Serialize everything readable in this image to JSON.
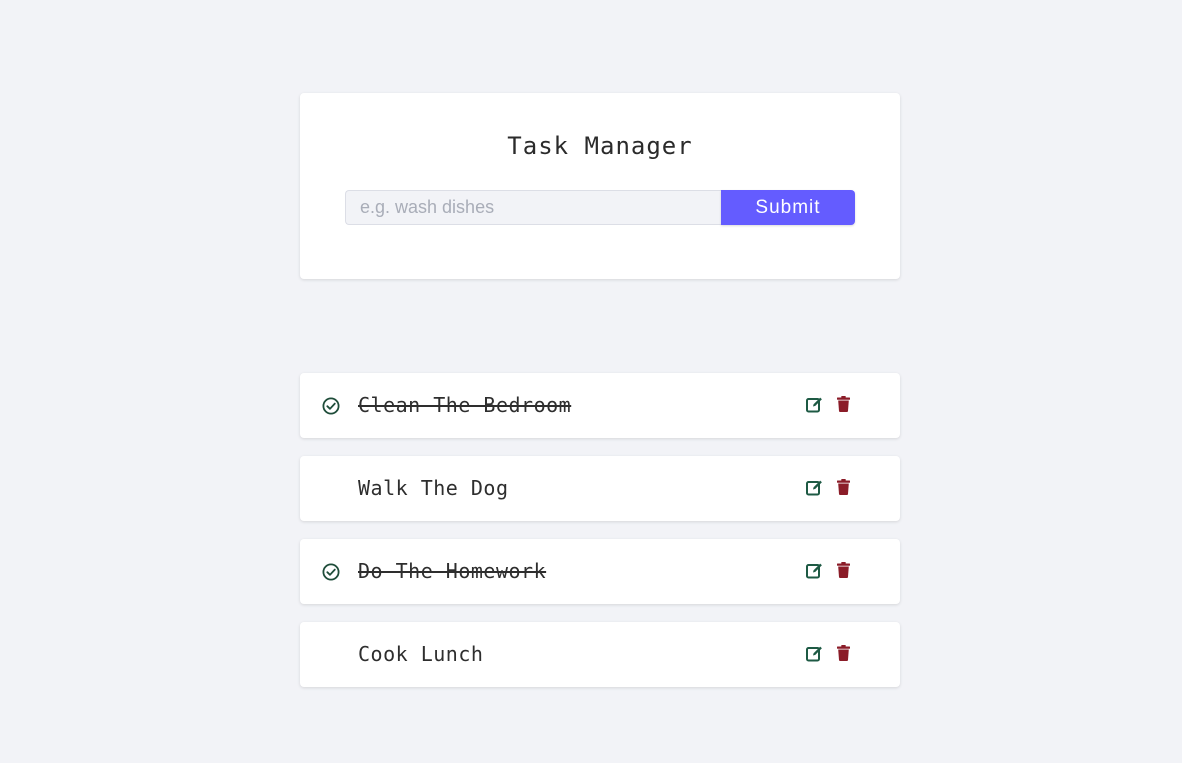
{
  "header": {
    "title": "Task Manager"
  },
  "form": {
    "input_value": "",
    "placeholder": "e.g. wash dishes",
    "submit_label": "Submit"
  },
  "tasks": [
    {
      "name": "Clean The Bedroom",
      "completed": true
    },
    {
      "name": "Walk The Dog",
      "completed": false
    },
    {
      "name": "Do The Homework",
      "completed": true
    },
    {
      "name": "Cook Lunch",
      "completed": false
    }
  ],
  "colors": {
    "background": "#f2f3f7",
    "accent": "#645cff",
    "check": "#1f4d3a",
    "edit": "#1e5a44",
    "delete": "#8b1c28"
  },
  "icons": {
    "check": "check-circle-icon",
    "edit": "edit-icon",
    "delete": "trash-icon"
  }
}
